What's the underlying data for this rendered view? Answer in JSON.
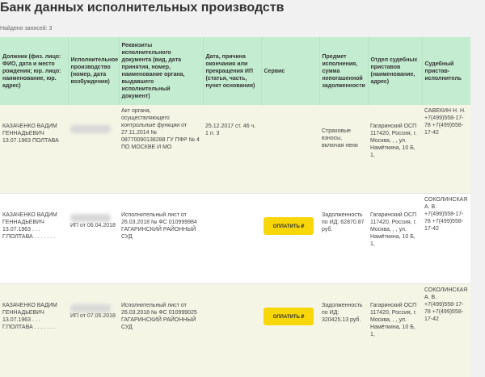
{
  "title": "Банк данных исполнительных производств",
  "found": "Найдено записей: 3",
  "columns": [
    "Должник (физ. лицо: ФИО, дата и место рождения; юр. лицо: наименование, юр. адрес)",
    "Исполнительное производство (номер, дата возбуждения)",
    "Реквизиты исполнительного документа (вид, дата принятия, номер, наименование органа, выдавшего исполнительный документ)",
    "Дата, причина окончания или прекращения ИП (статья, часть, пункт основания)",
    "Сервис",
    "Предмет исполнения, сумма непогашенной задолженности",
    "Отдел судебных приставов (наименование, адрес)",
    "Судебный пристав-исполнитель"
  ],
  "rows": [
    {
      "debtor": "КАЗАЧЕНКО ВАДИМ ГЕННАДЬЕВИЧ 13.07.1963 ПОЛТАВА",
      "proceeding": "",
      "document": "Акт органа, осуществляющего контрольные функции от 27.11.2014 № 08770090138288 ГУ ПФР № 4 ПО МОСКВЕ И МО",
      "end": "25.12.2017 ст. 46 ч. 1 п. 3",
      "service": "",
      "subject": "Страховые взносы, включая пени",
      "department": "Гагаринский ОСП 117420, Россия, г. Москва, , , ул. Намёткина, 10 Б, 1,",
      "bailiff": "САВЕКИН Н. Н. +7(499)558-17-78 +7(499)558-17-42"
    },
    {
      "debtor": "КАЗАЧЕНКО ВАДИМ ГЕННАДЬЕВИЧ 13.07.1963 . . . Г.ПОЛТАВА . . . . . . .",
      "proceeding": "ИП от 06.04.2018",
      "document": "Исполнительный лист от 26.03.2018 № ФС 010999984 ГАГАРИНСКИЙ РАЙОННЫЙ СУД",
      "end": "",
      "service": "ОПЛАТИТЬ ₽",
      "subject": "Задолженность по ИД: 62870.87 руб.",
      "department": "Гагаринский ОСП 117420, Россия, г. Москва, , , ул. Намёткина, 10 Б, 1,",
      "bailiff": "СОКОЛИНСКАЯ А. В. +7(499)558-17-78 +7(499)558-17-42"
    },
    {
      "debtor": "КАЗАЧЕНКО ВАДИМ ГЕННАДЬЕВИЧ 13.07.1963 . . . Г.ПОЛТАВА . . . . . . .",
      "proceeding": "ИП от 07.05.2018",
      "document": "Исполнительный лист от 26.03.2018 № ФС 010999025 ГАГАРИНСКИЙ РАЙОННЫЙ СУД",
      "end": "",
      "service": "ОПЛАТИТЬ ₽",
      "subject": "Задолженность по ИД: 320425.13 руб.",
      "department": "Гагаринский ОСП 117420, Россия, г. Москва, , , ул. Намёткина, 10 Б, 1,",
      "bailiff": "СОКОЛИНСКАЯ А. В. +7(499)558-17-78 +7(499)558-17-42"
    }
  ]
}
